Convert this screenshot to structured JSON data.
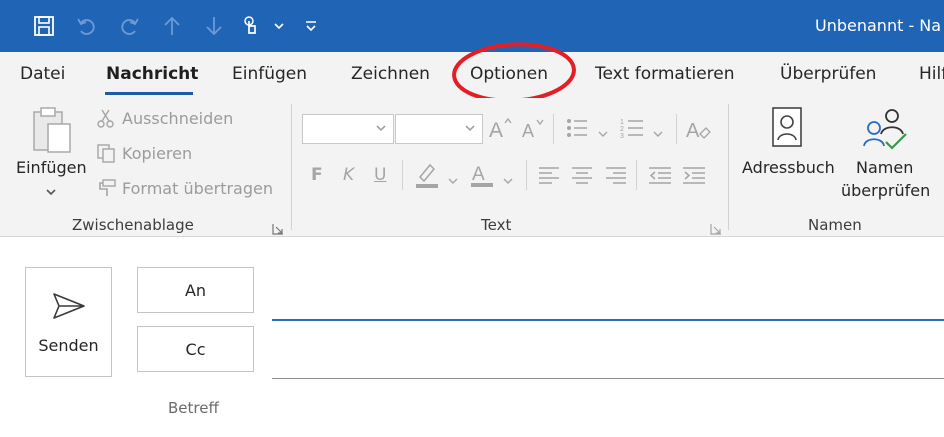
{
  "window": {
    "title": "Unbenannt  -  Na"
  },
  "colors": {
    "titlebar": "#2064b6",
    "accent": "#1f5ba6",
    "annotation": "#e31e24"
  },
  "quick_access": [
    {
      "icon": "save-icon"
    },
    {
      "icon": "undo-icon"
    },
    {
      "icon": "redo-icon"
    },
    {
      "icon": "arrow-up-icon"
    },
    {
      "icon": "arrow-down-icon"
    },
    {
      "icon": "touch-mode-icon"
    },
    {
      "icon": "customize-toolbar-icon"
    }
  ],
  "tabs": [
    {
      "label": "Datei"
    },
    {
      "label": "Nachricht",
      "active": true
    },
    {
      "label": "Einfügen"
    },
    {
      "label": "Zeichnen"
    },
    {
      "label": "Optionen",
      "highlighted": true
    },
    {
      "label": "Text formatieren"
    },
    {
      "label": "Überprüfen"
    },
    {
      "label": "Hilfe"
    }
  ],
  "ribbon": {
    "clipboard": {
      "paste_label": "Einfügen",
      "cut_label": "Ausschneiden",
      "copy_label": "Kopieren",
      "format_painter_label": "Format übertragen",
      "group_label": "Zwischenablage"
    },
    "text": {
      "bold": "F",
      "italic": "K",
      "underline": "U",
      "group_label": "Text",
      "font_name_value": "",
      "font_size_value": ""
    },
    "names": {
      "address_book_label": "Adressbuch",
      "check_names_line1": "Namen",
      "check_names_line2": "überprüfen",
      "group_label": "Namen"
    }
  },
  "compose": {
    "send_label": "Senden",
    "to_label": "An",
    "cc_label": "Cc",
    "subject_label": "Betreff",
    "to_value": "",
    "cc_value": "",
    "subject_value": ""
  }
}
